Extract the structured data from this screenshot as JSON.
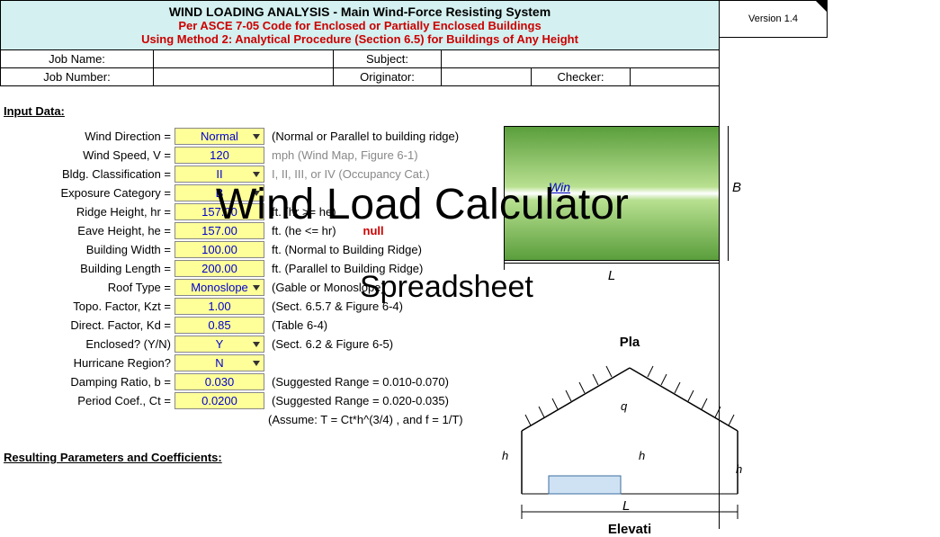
{
  "version": "Version 1.4",
  "header": {
    "title": "WIND LOADING ANALYSIS - Main Wind-Force Resisting System",
    "subtitle1": "Per ASCE 7-05 Code for Enclosed or Partially Enclosed Buildings",
    "subtitle2": "Using Method 2: Analytical Procedure (Section 6.5) for Buildings of Any Height"
  },
  "info": {
    "job_name_label": "Job Name:",
    "subject_label": "Subject:",
    "job_number_label": "Job Number:",
    "originator_label": "Originator:",
    "checker_label": "Checker:"
  },
  "sections": {
    "input_data": "Input Data:",
    "resulting": "Resulting Parameters and Coefficients:"
  },
  "inputs": [
    {
      "label": "Wind Direction =",
      "value": "Normal",
      "dropdown": true,
      "note": "(Normal or Parallel to building ridge)"
    },
    {
      "label": "Wind Speed, V =",
      "value": "120",
      "note_gray": "mph  (Wind Map, Figure 6-1)"
    },
    {
      "label": "Bldg. Classification =",
      "value": "II",
      "dropdown": true,
      "note_gray": "I,    II, III, or IV  (Occupancy Cat.)"
    },
    {
      "label": "Exposure Category =",
      "value": "B",
      "dropdown": true,
      "note": ""
    },
    {
      "label": "Ridge Height, hr =",
      "value": "157.00",
      "note": "ft. (hr >= he)"
    },
    {
      "label": "Eave Height, he =",
      "value": "157.00",
      "note": "ft. (he <= hr)",
      "extra_red": "null"
    },
    {
      "label": "Building Width =",
      "value": "100.00",
      "note": "ft. (Normal to Building Ridge)"
    },
    {
      "label": "Building Length =",
      "value": "200.00",
      "note": "ft. (Parallel to Building Ridge)"
    },
    {
      "label": "Roof Type =",
      "value": "Monoslope",
      "dropdown": true,
      "note": "(Gable or Monoslope)"
    },
    {
      "label": "Topo. Factor, Kzt =",
      "value": "1.00",
      "note": "(Sect. 6.5.7 & Figure 6-4)"
    },
    {
      "label": "Direct. Factor, Kd =",
      "value": "0.85",
      "note": "(Table 6-4)"
    },
    {
      "label": "Enclosed? (Y/N)",
      "value": "Y",
      "dropdown": true,
      "note": "(Sect. 6.2 & Figure 6-5)"
    },
    {
      "label": "Hurricane Region?",
      "value": "N",
      "dropdown": true,
      "note": ""
    },
    {
      "label": "Damping Ratio, b =",
      "value": "0.030",
      "note": "(Suggested Range = 0.010-0.070)"
    },
    {
      "label": "Period Coef., Ct =",
      "value": "0.0200",
      "note": "(Suggested Range = 0.020-0.035)"
    }
  ],
  "assume_note": "(Assume: T = Ct*h^(3/4) , and f = 1/T)",
  "diagram": {
    "win": "Win",
    "L": "L",
    "B": "B",
    "plan": "Pla",
    "q": "q",
    "h": "h",
    "elev": "Elevati"
  },
  "watermark": {
    "line1": "Wind Load Calculator",
    "line2": "Spreadsheet"
  }
}
